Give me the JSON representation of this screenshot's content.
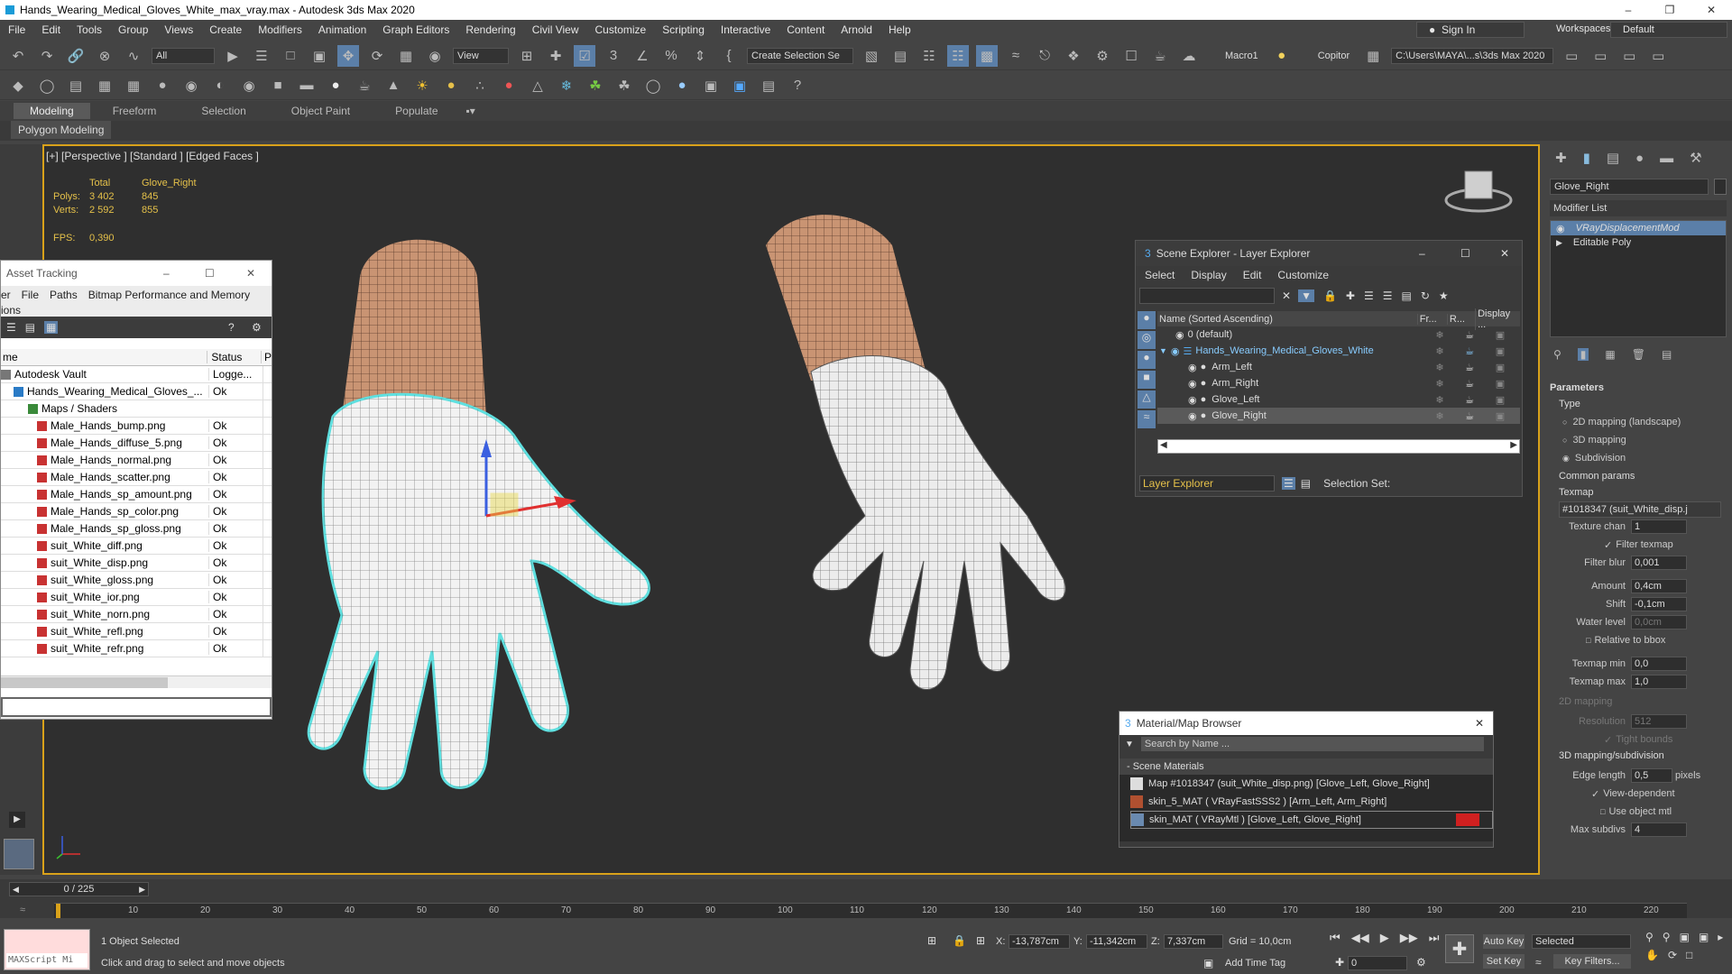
{
  "app": {
    "title": "Hands_Wearing_Medical_Gloves_White_max_vray.max - Autodesk 3ds Max 2020"
  },
  "menu": [
    "File",
    "Edit",
    "Tools",
    "Group",
    "Views",
    "Create",
    "Modifiers",
    "Animation",
    "Graph Editors",
    "Rendering",
    "Civil View",
    "Customize",
    "Scripting",
    "Interactive",
    "Content",
    "Arnold",
    "Help"
  ],
  "signin": {
    "label": "Sign In",
    "workspace_label": "Workspaces:",
    "workspace_value": "Default"
  },
  "toolbar": {
    "filter_value": "All",
    "view_value": "View",
    "selection_set": "Create Selection Se",
    "macro": "Macro1",
    "copitor": "Copitor",
    "path": "C:\\Users\\MAYA\\...s\\3ds Max 2020"
  },
  "ribbon": {
    "tabs": [
      "Modeling",
      "Freeform",
      "Selection",
      "Object Paint",
      "Populate"
    ],
    "sub": "Polygon Modeling"
  },
  "viewport": {
    "label": "[+] [Perspective ] [Standard ] [Edged Faces ]",
    "stats": {
      "total_hdr": "Total",
      "obj_hdr": "Glove_Right",
      "polys_lbl": "Polys:",
      "polys_total": "3 402",
      "polys_obj": "845",
      "verts_lbl": "Verts:",
      "verts_total": "2 592",
      "verts_obj": "855",
      "fps_lbl": "FPS:",
      "fps_val": "0,390"
    }
  },
  "asset_tracking": {
    "title": "Asset Tracking",
    "menu": [
      "er",
      "File",
      "Paths",
      "Bitmap Performance and Memory"
    ],
    "menu2": "ions",
    "col_name": "me",
    "col_status": "Status",
    "col_p": "P",
    "rows": [
      {
        "name": "Autodesk Vault",
        "status": "Logge..."
      },
      {
        "name": "Hands_Wearing_Medical_Gloves_...",
        "status": "Ok"
      },
      {
        "name": "Maps / Shaders",
        "status": ""
      },
      {
        "name": "Male_Hands_bump.png",
        "status": "Ok"
      },
      {
        "name": "Male_Hands_diffuse_5.png",
        "status": "Ok"
      },
      {
        "name": "Male_Hands_normal.png",
        "status": "Ok"
      },
      {
        "name": "Male_Hands_scatter.png",
        "status": "Ok"
      },
      {
        "name": "Male_Hands_sp_amount.png",
        "status": "Ok"
      },
      {
        "name": "Male_Hands_sp_color.png",
        "status": "Ok"
      },
      {
        "name": "Male_Hands_sp_gloss.png",
        "status": "Ok"
      },
      {
        "name": "suit_White_diff.png",
        "status": "Ok"
      },
      {
        "name": "suit_White_disp.png",
        "status": "Ok"
      },
      {
        "name": "suit_White_gloss.png",
        "status": "Ok"
      },
      {
        "name": "suit_White_ior.png",
        "status": "Ok"
      },
      {
        "name": "suit_White_norn.png",
        "status": "Ok"
      },
      {
        "name": "suit_White_refl.png",
        "status": "Ok"
      },
      {
        "name": "suit_White_refr.png",
        "status": "Ok"
      }
    ]
  },
  "scene_explorer": {
    "title": "Scene Explorer - Layer Explorer",
    "menu": [
      "Select",
      "Display",
      "Edit",
      "Customize"
    ],
    "col_name": "Name (Sorted Ascending)",
    "col_fr": "Fr...",
    "col_r": "R...",
    "col_disp": "Display ...",
    "rows": [
      "0 (default)",
      "Hands_Wearing_Medical_Gloves_White",
      "Arm_Left",
      "Arm_Right",
      "Glove_Left",
      "Glove_Right"
    ],
    "footer_label": "Layer Explorer",
    "selection_set": "Selection Set:"
  },
  "material_browser": {
    "title": "Material/Map Browser",
    "search": "Search by Name ...",
    "section": "- Scene Materials",
    "rows": [
      "Map #1018347 (suit_White_disp.png) [Glove_Left, Glove_Right]",
      "skin_5_MAT ( VRayFastSSS2 ) [Arm_Left, Arm_Right]",
      "skin_MAT ( VRayMtl ) [Glove_Left, Glove_Right]"
    ]
  },
  "command_panel": {
    "object_name": "Glove_Right",
    "modifier_list": "Modifier List",
    "stack": [
      "VRayDisplacementMod",
      "Editable Poly"
    ],
    "parameters": "Parameters",
    "type_lbl": "Type",
    "type_opts": [
      "2D mapping (landscape)",
      "3D mapping",
      "Subdivision"
    ],
    "common": "Common params",
    "texmap": "Texmap",
    "texmap_val": "#1018347 (suit_White_disp.j",
    "texchan_lbl": "Texture chan",
    "texchan_val": "1",
    "filter_texmap": "Filter texmap",
    "filter_blur_lbl": "Filter blur",
    "filter_blur_val": "0,001",
    "amount_lbl": "Amount",
    "amount_val": "0,4cm",
    "shift_lbl": "Shift",
    "shift_val": "-0,1cm",
    "water_lbl": "Water level",
    "water_val": "0,0cm",
    "rel_bbox": "Relative to bbox",
    "texmin_lbl": "Texmap min",
    "texmin_val": "0,0",
    "texmax_lbl": "Texmap max",
    "texmax_val": "1,0",
    "map2d": "2D mapping",
    "res_lbl": "Resolution",
    "res_val": "512",
    "tight": "Tight bounds",
    "map3d": "3D mapping/subdivision",
    "edge_lbl": "Edge length",
    "edge_val": "0,5",
    "pixels": "pixels",
    "viewdep": "View-dependent",
    "useobj": "Use object mtl",
    "maxsub_lbl": "Max subdivs",
    "maxsub_val": "4"
  },
  "timeline": {
    "frame": "0 / 225",
    "ticks": [
      "10",
      "20",
      "30",
      "40",
      "50",
      "60",
      "70",
      "80",
      "90",
      "100",
      "110",
      "120",
      "130",
      "140",
      "150",
      "160",
      "170",
      "180",
      "190",
      "200",
      "210",
      "220"
    ]
  },
  "status": {
    "selected": "1 Object Selected",
    "hint": "Click and drag to select and move objects",
    "maxscript": "MAXScript Mi",
    "x_lbl": "X:",
    "x_val": "-13,787cm",
    "y_lbl": "Y:",
    "y_val": "-11,342cm",
    "z_lbl": "Z:",
    "z_val": "7,337cm",
    "grid": "Grid = 10,0cm",
    "add_time_tag": "Add Time Tag",
    "auto_key": "Auto Key",
    "set_key": "Set Key",
    "selected_dd": "Selected",
    "key_filters": "Key Filters...",
    "frame_val": "0"
  }
}
